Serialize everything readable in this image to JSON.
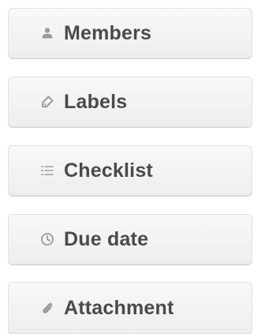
{
  "sidebar": {
    "items": [
      {
        "label": "Members",
        "icon": "person-icon"
      },
      {
        "label": "Labels",
        "icon": "tag-icon"
      },
      {
        "label": "Checklist",
        "icon": "checklist-icon"
      },
      {
        "label": "Due date",
        "icon": "clock-icon"
      },
      {
        "label": "Attachment",
        "icon": "paperclip-icon"
      }
    ]
  },
  "colors": {
    "button_bg": "#f3f3f3",
    "button_border": "#e0e0e0",
    "label_text": "#4a4a4a",
    "icon_color": "#9a9a9a"
  }
}
